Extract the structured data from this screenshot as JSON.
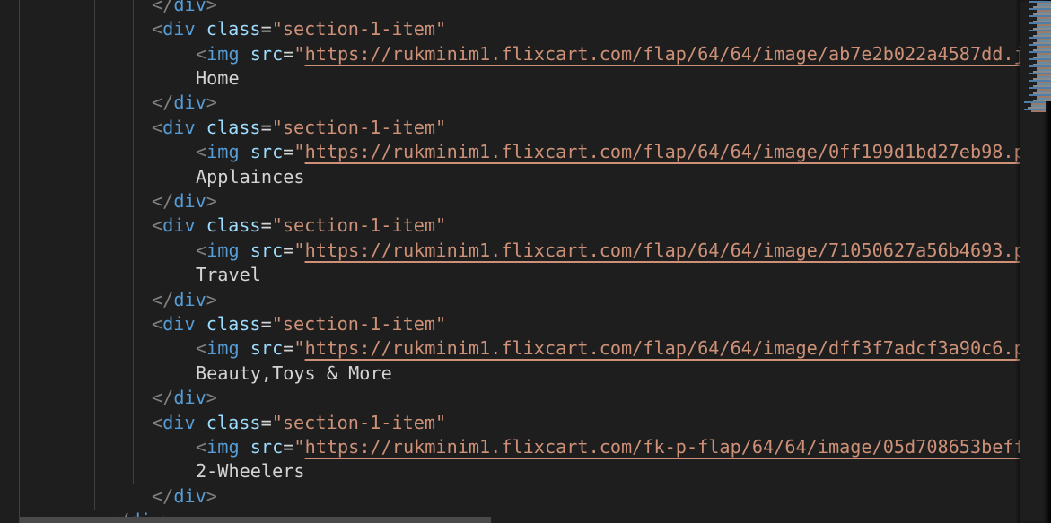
{
  "editor": {
    "tag_div": "div",
    "tag_img": "img",
    "attr_class": "class",
    "attr_src": "src",
    "class_value": "section-1-item",
    "items": [
      {
        "url": "https://rukminim1.flixcart.com/flap/64/64/image/ab7e2b022a4587dd.j",
        "label": "Home"
      },
      {
        "url": "https://rukminim1.flixcart.com/flap/64/64/image/0ff199d1bd27eb98.p",
        "label": "Applainces"
      },
      {
        "url": "https://rukminim1.flixcart.com/flap/64/64/image/71050627a56b4693.p",
        "label": "Travel"
      },
      {
        "url": "https://rukminim1.flixcart.com/flap/64/64/image/dff3f7adcf3a90c6.p",
        "label": "Beauty,Toys & More"
      },
      {
        "url": "https://rukminim1.flixcart.com/fk-p-flap/64/64/image/05d708653beff",
        "label": "2-Wheelers"
      }
    ]
  }
}
